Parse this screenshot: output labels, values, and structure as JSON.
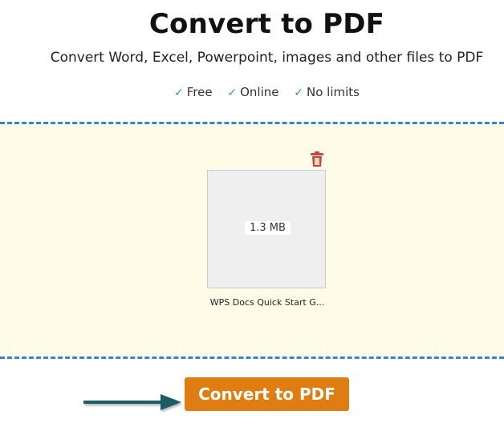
{
  "header": {
    "title": "Convert to PDF",
    "subtitle": "Convert Word, Excel, Powerpoint, images and other files to PDF"
  },
  "features": [
    {
      "check": "✓",
      "label": "Free"
    },
    {
      "check": "✓",
      "label": "Online"
    },
    {
      "check": "✓",
      "label": "No limits"
    }
  ],
  "dropzone": {
    "file": {
      "size": "1.3 MB",
      "name": "WPS Docs Quick Start G..."
    },
    "delete_icon": "trash-icon"
  },
  "actions": {
    "convert_label": "Convert to PDF"
  },
  "colors": {
    "dropzone_bg": "#fefce6",
    "dropzone_border": "#2f86d3",
    "convert_button": "#e07d12",
    "check": "#3aa34a",
    "trash": "#c9453a",
    "arrow": "#1d5c63"
  }
}
